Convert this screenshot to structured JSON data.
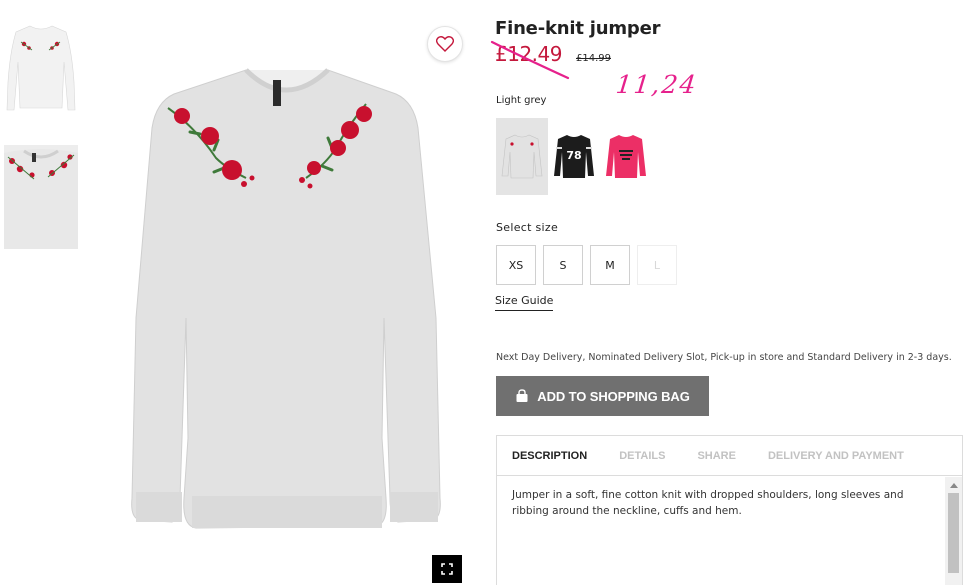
{
  "product": {
    "title": "Fine-knit jumper",
    "sale_price": "£12.49",
    "original_price": "£14.99",
    "handwritten_note": "11,24",
    "color_label": "Light grey"
  },
  "swatches": [
    {
      "name": "Light grey",
      "selected": true
    },
    {
      "name": "Black 78",
      "selected": false
    },
    {
      "name": "Pink",
      "selected": false
    }
  ],
  "sizes": {
    "label": "Select size",
    "options": [
      {
        "label": "XS",
        "available": true
      },
      {
        "label": "S",
        "available": true
      },
      {
        "label": "M",
        "available": true
      },
      {
        "label": "L",
        "available": false
      }
    ],
    "guide_label": "Size Guide"
  },
  "delivery_note": "Next Day Delivery, Nominated Delivery Slot, Pick-up in store and Standard Delivery in 2-3 days.",
  "add_to_bag_label": "ADD TO SHOPPING BAG",
  "tabs": [
    {
      "label": "DESCRIPTION",
      "active": true
    },
    {
      "label": "DETAILS",
      "active": false
    },
    {
      "label": "SHARE",
      "active": false
    },
    {
      "label": "DELIVERY AND PAYMENT",
      "active": false
    }
  ],
  "description": "Jumper in a soft, fine cotton knit with dropped shoulders, long sleeves and ribbing around the neckline, cuffs and hem.",
  "colors": {
    "sale_red": "#c4183c",
    "annotation_pink": "#e6218c",
    "button_grey": "#707070",
    "jumper_grey": "#e2e2e2",
    "rose_red": "#c8102e",
    "leaf_green": "#3f7a3a"
  },
  "icons": [
    "heart-icon",
    "fullscreen-icon",
    "shopping-bag-icon",
    "scroll-up-arrow-icon"
  ]
}
